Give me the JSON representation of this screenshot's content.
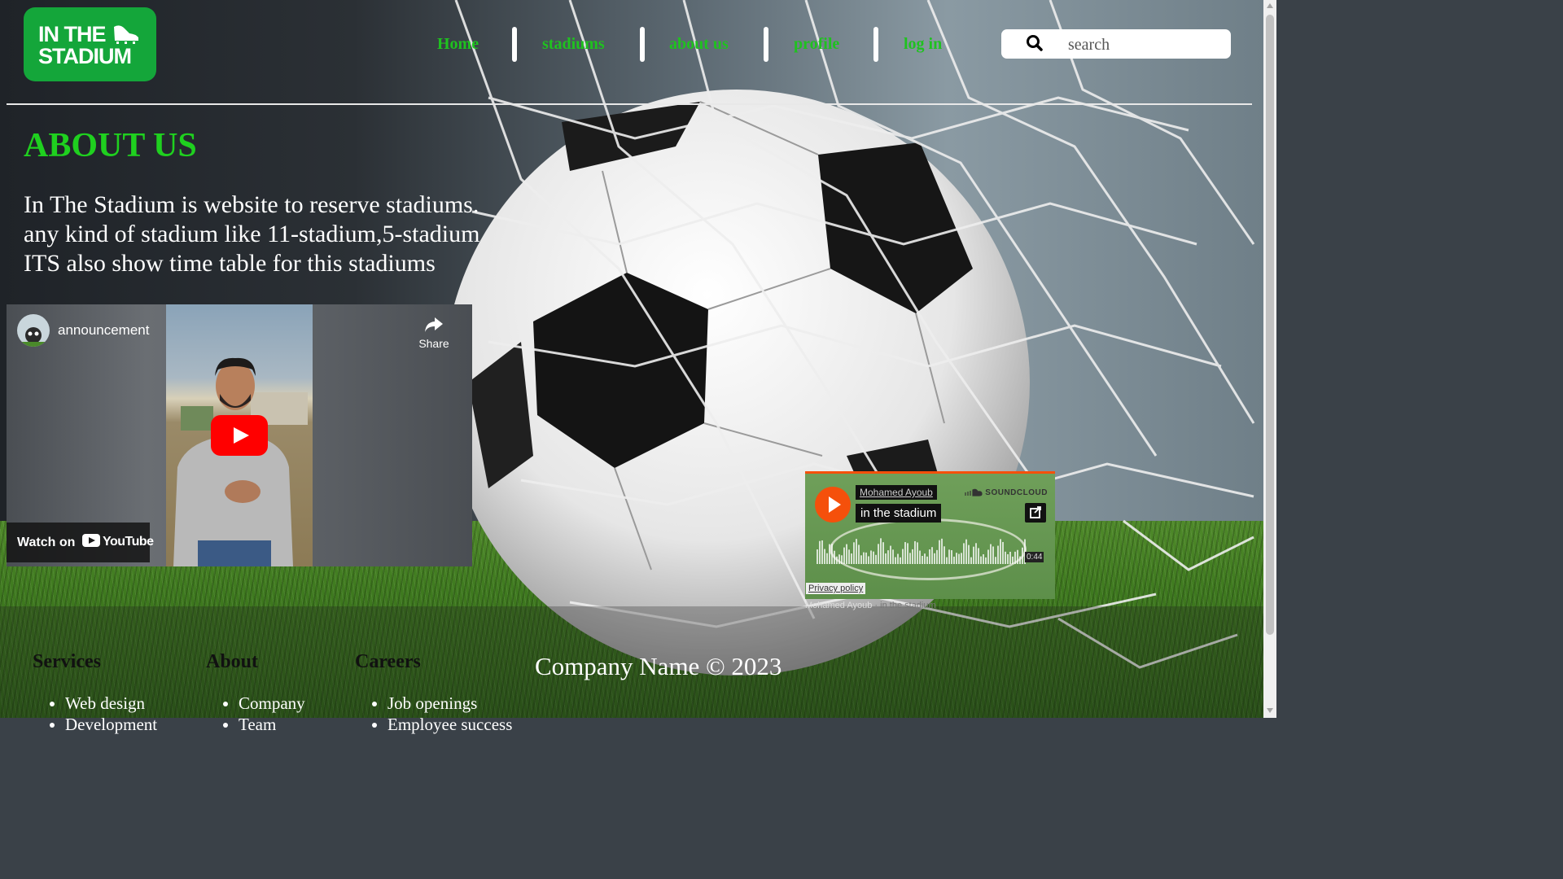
{
  "logo": {
    "line1": "IN THE",
    "line2": "STADIUM"
  },
  "nav": {
    "items": [
      {
        "label": "Home"
      },
      {
        "label": "stadiums"
      },
      {
        "label": "about us"
      },
      {
        "label": "profile"
      },
      {
        "label": "log in"
      }
    ]
  },
  "search": {
    "placeholder": "search"
  },
  "about": {
    "title": "ABOUT US",
    "lines": [
      "In The Stadium is website to reserve stadiums.",
      "any kind of stadium like 11-stadium,5-stadium",
      "ITS also show time table for this stadiums"
    ]
  },
  "youtube": {
    "title": "announcement",
    "share_label": "Share",
    "watch_on": "Watch on",
    "brand": "YouTube"
  },
  "soundcloud": {
    "artist": "Mohamed Ayoub",
    "track": "in the stadium",
    "brand": "SOUNDCLOUD",
    "duration": "0:44",
    "privacy": "Privacy policy",
    "caption_artist": "Mohamed Ayoub",
    "caption_track": "in the stadium"
  },
  "footer": {
    "columns": [
      {
        "heading": "Services",
        "items": [
          "Web design",
          "Development"
        ]
      },
      {
        "heading": "About",
        "items": [
          "Company",
          "Team"
        ]
      },
      {
        "heading": "Careers",
        "items": [
          "Job openings",
          "Employee success"
        ]
      }
    ],
    "copyright": "Company Name © 2023"
  },
  "colors": {
    "nav_link": "#1fc21f",
    "title": "#1fd01f",
    "logo_bg": "#14a63a",
    "soundcloud_accent": "#f5500b",
    "youtube_red": "#ff0000"
  }
}
